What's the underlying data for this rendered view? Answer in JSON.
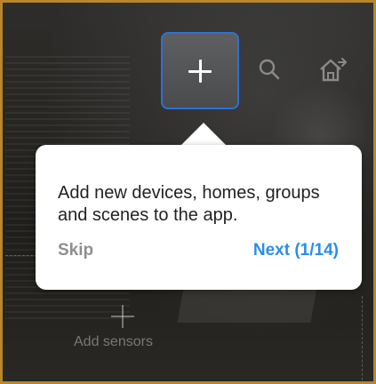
{
  "toolbar": {
    "add_icon": "plus-icon",
    "search_icon": "search-icon",
    "home_icon": "home-arrow-icon"
  },
  "tooltip": {
    "message": "Add new devices, homes, groups and scenes to the app.",
    "skip_label": "Skip",
    "next_label": "Next (1/14)"
  },
  "background": {
    "add_sensors_label": "Add sensors"
  },
  "colors": {
    "accent": "#2b8ee8",
    "highlight_border": "#2f6fd6",
    "frame_border": "#b8862b",
    "skip_text": "#8e8e8e"
  }
}
